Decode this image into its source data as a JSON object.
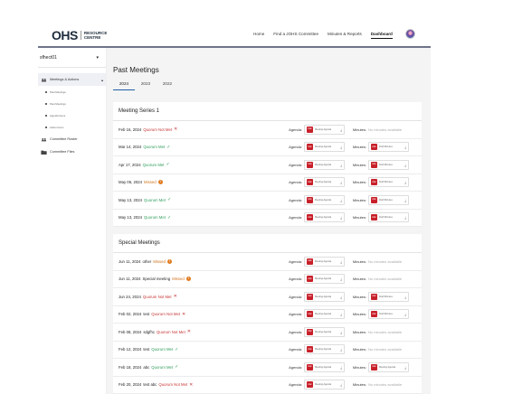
{
  "header": {
    "logo_mark": "OHS",
    "logo_line1": "RESOURCE",
    "logo_line2": "CENTRE",
    "nav": [
      "Home",
      "Find a JOHS Committee",
      "Minutes & Reports",
      "Dashboard"
    ],
    "active_nav": "Dashboard"
  },
  "sidebar": {
    "user": "sfhect01",
    "menu_label": "Meetings & Actions",
    "sub_items": [
      "Past Meetings",
      "Past Meetings",
      "Agenda Items",
      "Action Items"
    ],
    "committee_roster": "Committee Roster",
    "committee_files": "Committee Files"
  },
  "main": {
    "title": "Past Meetings",
    "tabs": [
      "2024",
      "2023",
      "2022"
    ],
    "active_tab": "2024"
  },
  "labels": {
    "agenda": "Agenda:",
    "minutes": "Minutes:",
    "no_minutes": "No minutes available",
    "pdf": "PDF"
  },
  "series1": {
    "title": "Meeting Series 1",
    "rows": [
      {
        "date": "Feb 16, 2024",
        "name": "",
        "status": "Quorum Not Met",
        "state": "bad",
        "agenda_file": "Meeting Agenda",
        "minutes_file": ""
      },
      {
        "date": "Mar 14, 2024",
        "name": "",
        "status": "Quorum Met",
        "state": "ok",
        "agenda_file": "Meeting Agenda",
        "minutes_file": "Draft Minutes"
      },
      {
        "date": "Apr 17, 2024",
        "name": "",
        "status": "Quorum Met",
        "state": "ok",
        "agenda_file": "Meeting Agenda",
        "minutes_file": "Draft Minutes"
      },
      {
        "date": "May 06, 2024",
        "name": "",
        "status": "Missed",
        "state": "missed",
        "agenda_file": "Meeting Agenda",
        "minutes_file": "Draft Minutes"
      },
      {
        "date": "May 13, 2024",
        "name": "",
        "status": "Quorum Met",
        "state": "ok",
        "agenda_file": "Meeting Agenda",
        "minutes_file": "Draft Minutes"
      },
      {
        "date": "May 13, 2024",
        "name": "",
        "status": "Quorum Met",
        "state": "ok",
        "agenda_file": "Meeting Agenda",
        "minutes_file": "Draft Minutes"
      }
    ]
  },
  "special": {
    "title": "Special Meetings",
    "rows": [
      {
        "date": "Jun 11, 2024",
        "name": "other",
        "status": "Missed",
        "state": "missed",
        "agenda_file": "Meeting Agenda",
        "minutes_file": ""
      },
      {
        "date": "Jun 11, 2024",
        "name": "Special meeting",
        "status": "Missed",
        "state": "missed",
        "agenda_file": "Meeting Agenda",
        "minutes_file": ""
      },
      {
        "date": "Jun 24, 2024",
        "name": "",
        "status": "Quorum Not Met",
        "state": "bad",
        "agenda_file": "Meeting Agenda",
        "minutes_file": "Draft Minutes"
      },
      {
        "date": "Feb 02, 2024",
        "name": "test",
        "status": "Quorum Not Met",
        "state": "bad",
        "agenda_file": "Meeting Agenda",
        "minutes_file": "Draft Minutes"
      },
      {
        "date": "Feb 08, 2024",
        "name": "sdgfhc",
        "status": "Quorum Not Met",
        "state": "bad",
        "agenda_file": "Meeting Agenda",
        "minutes_file": ""
      },
      {
        "date": "Feb 12, 2024",
        "name": "test",
        "status": "Quorum Met",
        "state": "ok",
        "agenda_file": "Meeting Agenda",
        "minutes_file": ""
      },
      {
        "date": "Feb 18, 2024",
        "name": "abc",
        "status": "Quorum Met",
        "state": "ok",
        "agenda_file": "Meeting Agenda",
        "minutes_file": "Meeting Agenda"
      },
      {
        "date": "Feb 20, 2024",
        "name": "test abc",
        "status": "Quorum Not Met",
        "state": "bad",
        "agenda_file": "Meeting Agenda",
        "minutes_file": ""
      }
    ]
  }
}
